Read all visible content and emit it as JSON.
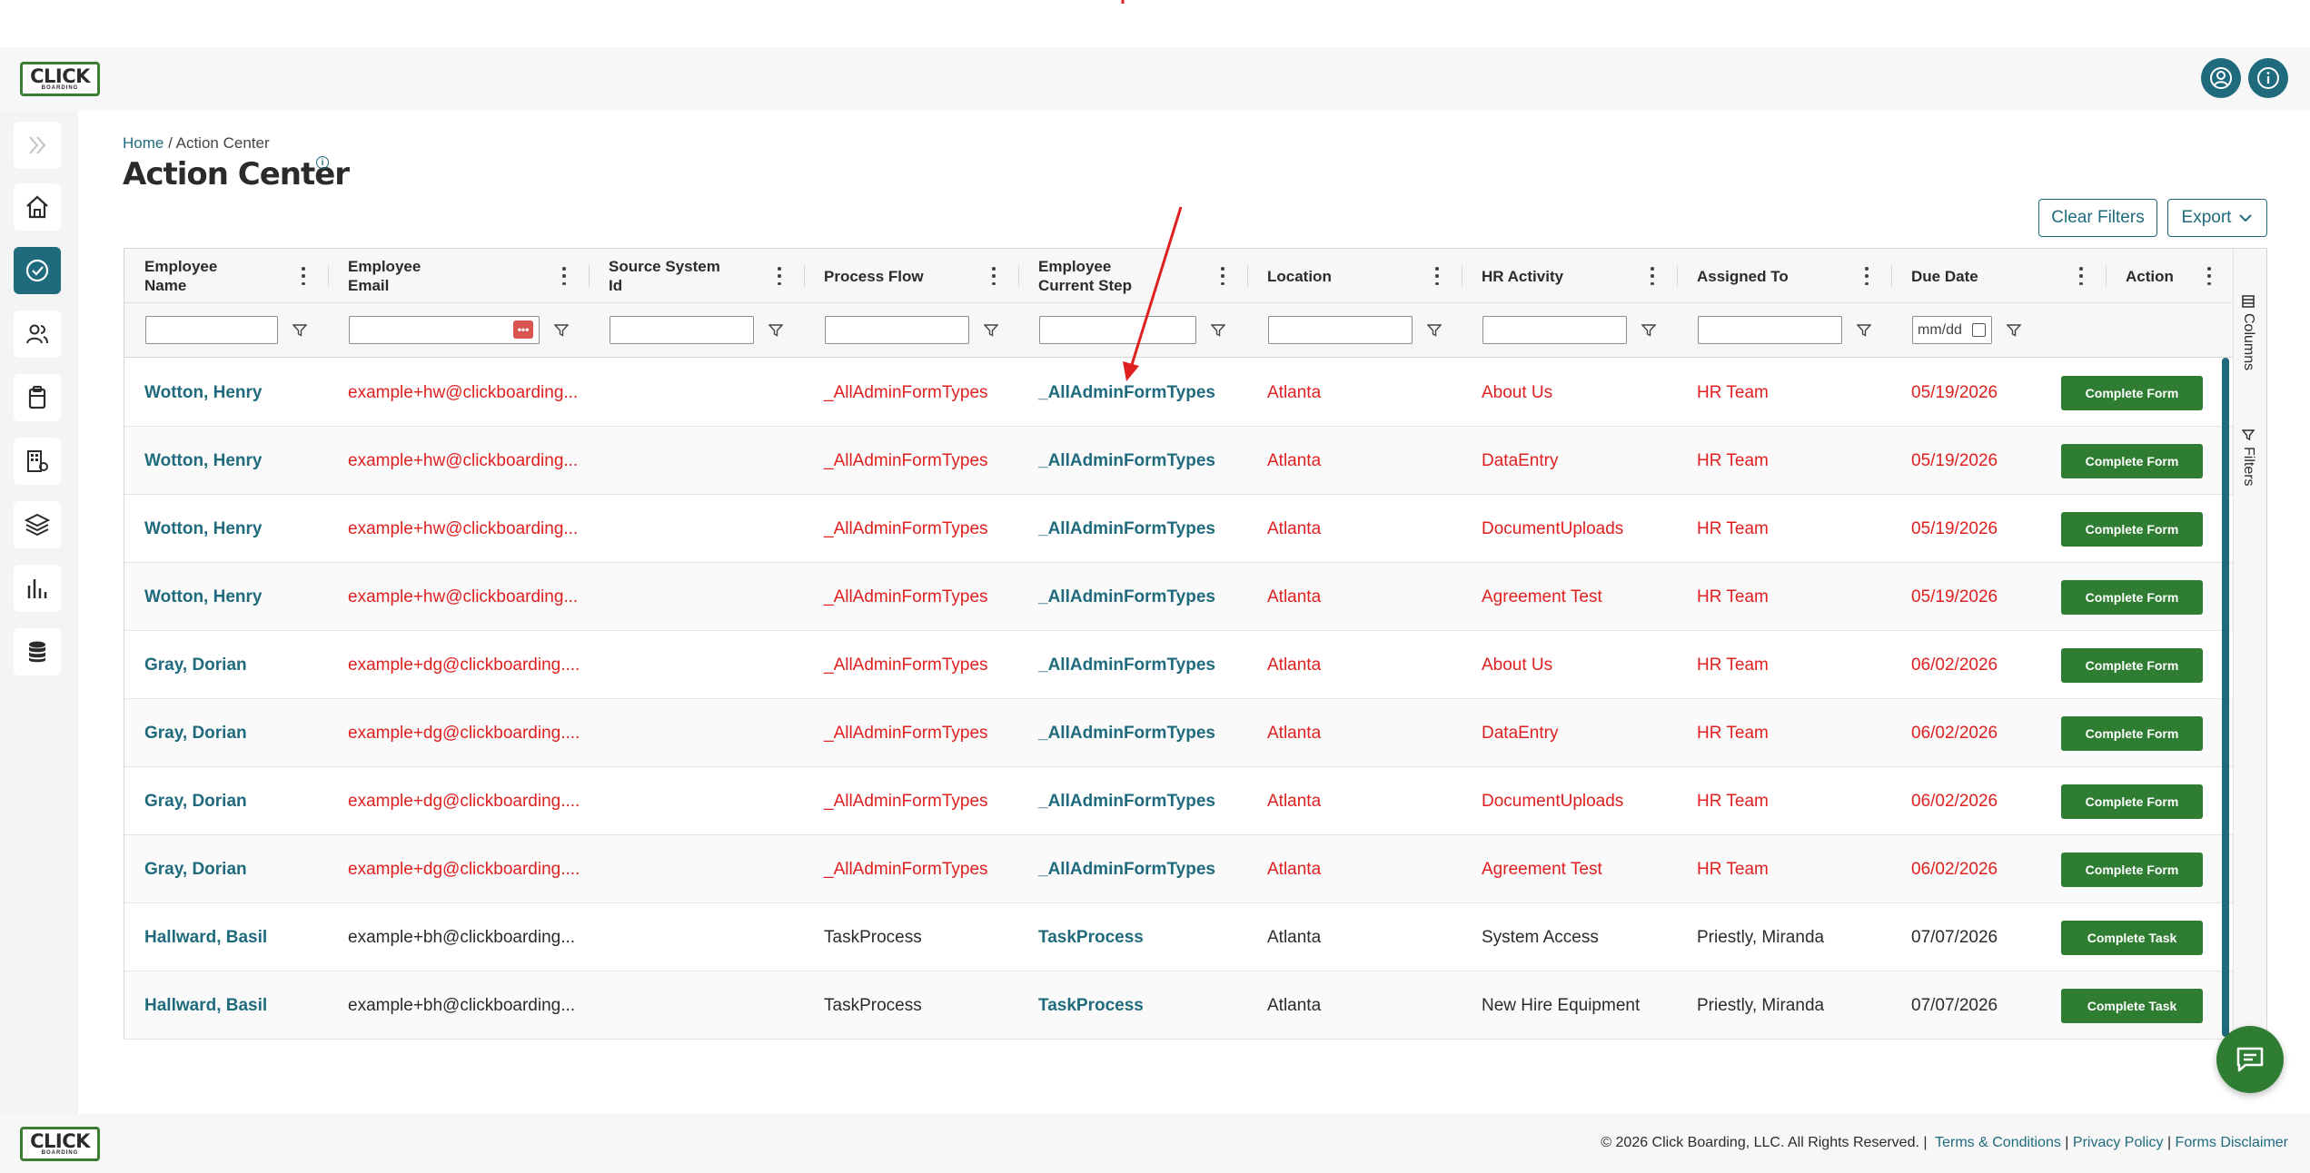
{
  "header": {
    "logo_text": "CLICK",
    "logo_sub": "BOARDING"
  },
  "breadcrumb": {
    "home": "Home",
    "sep": "/",
    "current": "Action Center"
  },
  "page_title": "Action Center",
  "title_info": "i",
  "toolbar": {
    "clear_filters": "Clear Filters",
    "export": "Export"
  },
  "filters": {
    "date_placeholder": "mm/dd",
    "email_dots": "•••"
  },
  "columns": [
    "Employee Name",
    "Employee Email",
    "Source System Id",
    "Process Flow",
    "Employee Current Step",
    "Location",
    "HR Activity",
    "Assigned To",
    "Due Date",
    "Action"
  ],
  "rows": [
    {
      "name": "Wotton, Henry",
      "email": "example+hw@clickboarding...",
      "source": "",
      "flow": "_AllAdminFormTypes",
      "step": "_AllAdminFormTypes",
      "location": "Atlanta",
      "activity": "About Us",
      "assigned": "HR Team",
      "due": "05/19/2026",
      "action": "Complete Form"
    },
    {
      "name": "Wotton, Henry",
      "email": "example+hw@clickboarding...",
      "source": "",
      "flow": "_AllAdminFormTypes",
      "step": "_AllAdminFormTypes",
      "location": "Atlanta",
      "activity": "DataEntry",
      "assigned": "HR Team",
      "due": "05/19/2026",
      "action": "Complete Form"
    },
    {
      "name": "Wotton, Henry",
      "email": "example+hw@clickboarding...",
      "source": "",
      "flow": "_AllAdminFormTypes",
      "step": "_AllAdminFormTypes",
      "location": "Atlanta",
      "activity": "DocumentUploads",
      "assigned": "HR Team",
      "due": "05/19/2026",
      "action": "Complete Form"
    },
    {
      "name": "Wotton, Henry",
      "email": "example+hw@clickboarding...",
      "source": "",
      "flow": "_AllAdminFormTypes",
      "step": "_AllAdminFormTypes",
      "location": "Atlanta",
      "activity": "Agreement Test",
      "assigned": "HR Team",
      "due": "05/19/2026",
      "action": "Complete Form"
    },
    {
      "name": "Gray, Dorian",
      "email": "example+dg@clickboarding....",
      "source": "",
      "flow": "_AllAdminFormTypes",
      "step": "_AllAdminFormTypes",
      "location": "Atlanta",
      "activity": "About Us",
      "assigned": "HR Team",
      "due": "06/02/2026",
      "action": "Complete Form"
    },
    {
      "name": "Gray, Dorian",
      "email": "example+dg@clickboarding....",
      "source": "",
      "flow": "_AllAdminFormTypes",
      "step": "_AllAdminFormTypes",
      "location": "Atlanta",
      "activity": "DataEntry",
      "assigned": "HR Team",
      "due": "06/02/2026",
      "action": "Complete Form"
    },
    {
      "name": "Gray, Dorian",
      "email": "example+dg@clickboarding....",
      "source": "",
      "flow": "_AllAdminFormTypes",
      "step": "_AllAdminFormTypes",
      "location": "Atlanta",
      "activity": "DocumentUploads",
      "assigned": "HR Team",
      "due": "06/02/2026",
      "action": "Complete Form"
    },
    {
      "name": "Gray, Dorian",
      "email": "example+dg@clickboarding....",
      "source": "",
      "flow": "_AllAdminFormTypes",
      "step": "_AllAdminFormTypes",
      "location": "Atlanta",
      "activity": "Agreement Test",
      "assigned": "HR Team",
      "due": "06/02/2026",
      "action": "Complete Form"
    },
    {
      "name": "Hallward, Basil",
      "email": "example+bh@clickboarding...",
      "source": "",
      "flow": "TaskProcess",
      "step": "TaskProcess",
      "location": "Atlanta",
      "activity": "System Access",
      "assigned": "Priestly, Miranda",
      "due": "07/07/2026",
      "action": "Complete Task"
    },
    {
      "name": "Hallward, Basil",
      "email": "example+bh@clickboarding...",
      "source": "",
      "flow": "TaskProcess",
      "step": "TaskProcess",
      "location": "Atlanta",
      "activity": "New Hire Equipment",
      "assigned": "Priestly, Miranda",
      "due": "07/07/2026",
      "action": "Complete Task"
    }
  ],
  "side_panel": {
    "columns": "Columns",
    "filters": "Filters"
  },
  "footer": {
    "copyright": "© 2026 Click Boarding, LLC. All Rights Reserved.",
    "sep": "|",
    "terms": "Terms & Conditions",
    "privacy": "Privacy Policy",
    "forms": "Forms Disclaimer"
  },
  "colors": {
    "brand": "#1f6b7d",
    "action_green": "#2f7d32",
    "alert_red": "#e02020"
  }
}
